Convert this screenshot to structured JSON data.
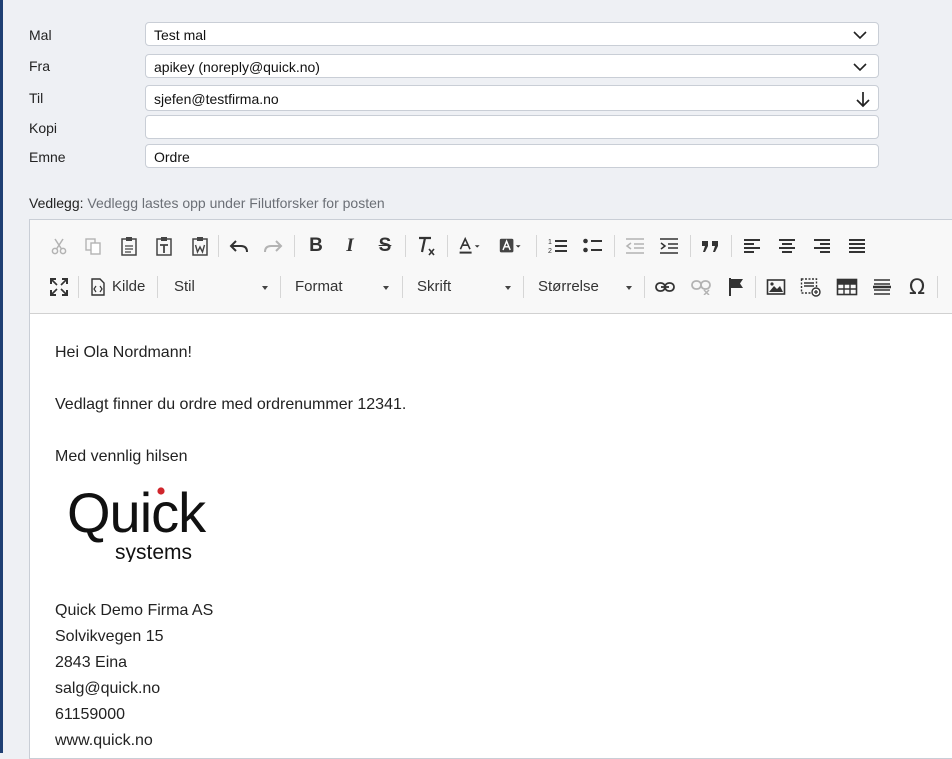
{
  "form": {
    "template": {
      "label": "Mal",
      "value": "Test mal"
    },
    "from": {
      "label": "Fra",
      "value": "apikey (noreply@quick.no)"
    },
    "to": {
      "label": "Til",
      "value": "sjefen@testfirma.no"
    },
    "cc": {
      "label": "Kopi",
      "value": ""
    },
    "subject": {
      "label": "Emne",
      "value": "Ordre"
    }
  },
  "attachments": {
    "label": "Vedlegg:",
    "text": "Vedlegg lastes opp under Filutforsker for posten"
  },
  "toolbar": {
    "source_label": "Kilde",
    "style_label": "Stil",
    "format_label": "Format",
    "font_label": "Skrift",
    "size_label": "Størrelse"
  },
  "body": {
    "greeting": "Hei Ola Nordmann!",
    "line1": "Vedlagt finner du ordre med ordrenummer 12341.",
    "closing": "Med vennlig hilsen",
    "logo_word": "Quick",
    "logo_sub": "systems",
    "company": "Quick Demo Firma AS",
    "address": "Solvikvegen 15",
    "postal": "2843 Eina",
    "email": "salg@quick.no",
    "phone": "61159000",
    "web": "www.quick.no"
  },
  "colors": {
    "accent_bar": "#1f3f73",
    "logo_dot": "#d0262c"
  }
}
